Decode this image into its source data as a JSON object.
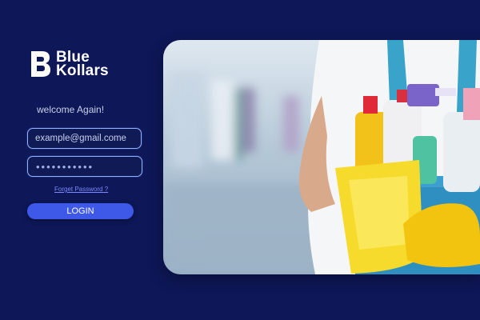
{
  "brand": {
    "line1": "Blue",
    "line2": "Kollars"
  },
  "login": {
    "welcome": "welcome Again!",
    "email_value": "example@gmail.come",
    "password_mask": "•••••••••••",
    "forgot_label": "Forget Password ?",
    "button_label": "LOGIN"
  },
  "colors": {
    "background": "#0e1757",
    "accent": "#3e58e8",
    "field_border": "#8fb2ff",
    "link": "#7b88ff"
  },
  "hero": {
    "icon": "cleaning-worker-photo"
  }
}
